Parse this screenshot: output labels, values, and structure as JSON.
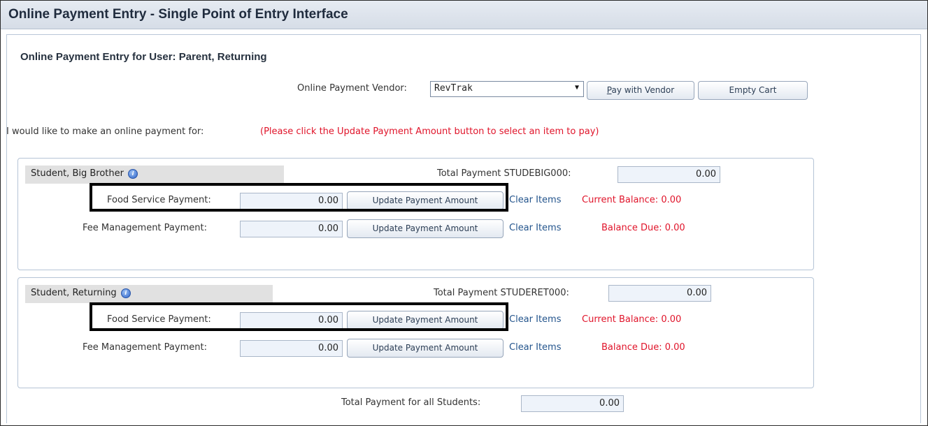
{
  "title": "Online Payment Entry - Single Point of Entry Interface",
  "subtitle": "Online Payment Entry for User: Parent, Returning",
  "vendor": {
    "label": "Online Payment Vendor:",
    "selected": "RevTrak",
    "pay_button": "Pay with Vendor",
    "empty_button": "Empty Cart"
  },
  "intro": {
    "text": "I would like to make an online payment for:",
    "note": "(Please click the Update Payment Amount button to select an item to pay)"
  },
  "students": [
    {
      "name": "Student, Big Brother",
      "total_label": "Total Payment STUDEBIG000:",
      "total_value": "0.00",
      "food": {
        "label": "Food Service Payment:",
        "value": "0.00",
        "button": "Update Payment Amount",
        "clear": "Clear Items",
        "status": "Current Balance: 0.00"
      },
      "fee": {
        "label": "Fee Management Payment:",
        "value": "0.00",
        "button": "Update Payment Amount",
        "clear": "Clear Items",
        "status": "Balance Due: 0.00"
      }
    },
    {
      "name": "Student, Returning",
      "total_label": "Total Payment STUDERET000:",
      "total_value": "0.00",
      "food": {
        "label": "Food Service Payment:",
        "value": "0.00",
        "button": "Update Payment Amount",
        "clear": "Clear Items",
        "status": "Current Balance: 0.00"
      },
      "fee": {
        "label": "Fee Management Payment:",
        "value": "0.00",
        "button": "Update Payment Amount",
        "clear": "Clear Items",
        "status": "Balance Due: 0.00"
      }
    }
  ],
  "grand_total": {
    "label": "Total Payment for all Students:",
    "value": "0.00"
  },
  "icons": {
    "info": "info-icon",
    "dropdown": "chevron-down-icon"
  },
  "colors": {
    "accent_red": "#e0142a",
    "link_blue": "#23548c",
    "header_bg": "#dfe5ee"
  }
}
